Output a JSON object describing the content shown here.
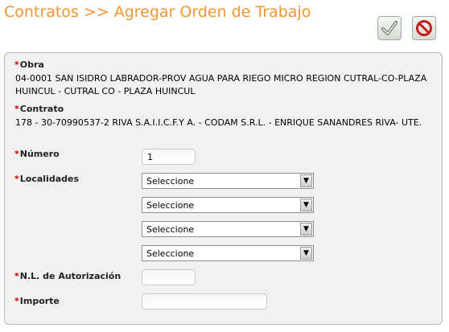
{
  "header": {
    "title": "Contratos >> Agregar Orden de Trabajo"
  },
  "toolbar": {
    "accept_icon": "check-icon",
    "cancel_icon": "prohibited-icon"
  },
  "form": {
    "obra": {
      "label": "Obra",
      "value": "04-0001 SAN ISIDRO LABRADOR-PROV AGUA PARA RIEGO MICRO REGION CUTRAL-CO-PLAZA HUINCUL - CUTRAL CO - PLAZA HUINCUL"
    },
    "contrato": {
      "label": "Contrato",
      "value": "178 - 30-70990537-2 RIVA S.A.I.I.C.F.Y A. - CODAM S.R.L. - ENRIQUE SANANDRES RIVA- UTE."
    },
    "numero": {
      "label": "Número",
      "value": "1"
    },
    "localidades": {
      "label": "Localidades",
      "options": [
        "Seleccione",
        "Seleccione",
        "Seleccione",
        "Seleccione"
      ]
    },
    "nl_autorizacion": {
      "label": "N.L. de Autorización",
      "value": ""
    },
    "importe": {
      "label": "Importe",
      "value": ""
    }
  },
  "colors": {
    "title": "#f0962e",
    "required": "#c40000",
    "panel_bg": "#f1f1f1"
  }
}
